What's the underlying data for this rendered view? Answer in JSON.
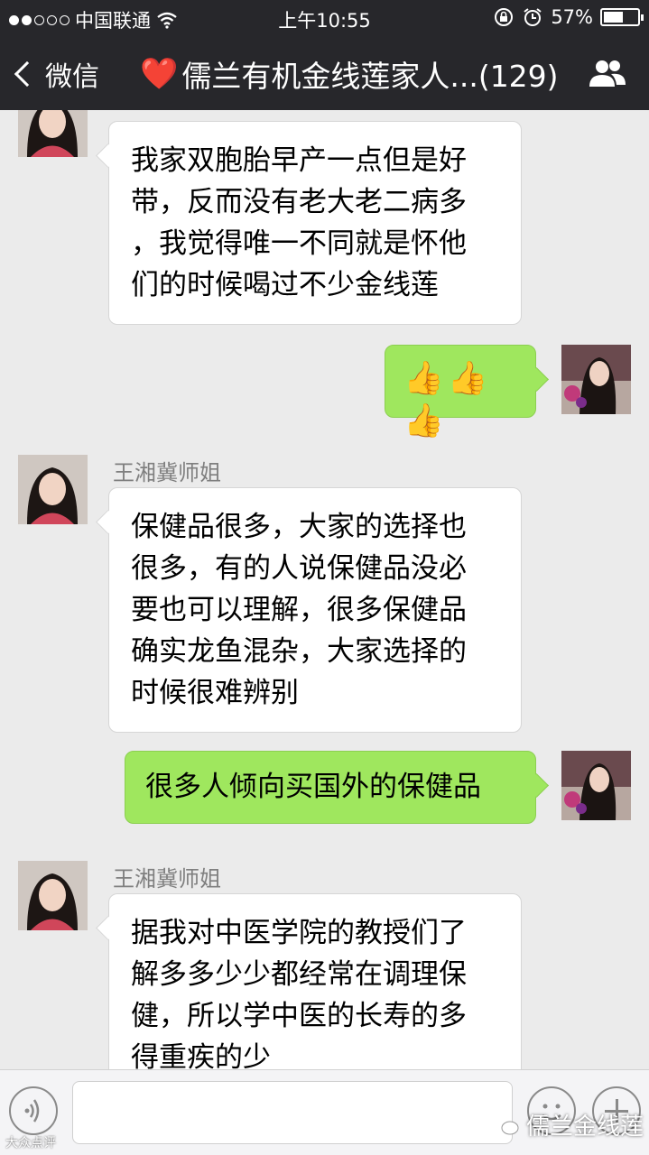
{
  "status_bar": {
    "carrier": "中国联通",
    "time": "上午10:55",
    "battery_percent": "57%",
    "battery_level": 0.57
  },
  "nav": {
    "back_label": "微信",
    "title": "儒兰有机金线莲家人...(129)",
    "heart_glyph": "❤️"
  },
  "messages": [
    {
      "side": "in",
      "sender": "",
      "lines": [
        "我家双胞胎早产一点但是好",
        "带，反而没有老大老二病多",
        "，我觉得唯一不同就是怀他",
        "们的时候喝过不少金线莲"
      ]
    },
    {
      "side": "out",
      "text": "👍👍👍"
    },
    {
      "side": "in",
      "sender": "王湘冀师姐",
      "lines": [
        "保健品很多，大家的选择也",
        "很多，有的人说保健品没必",
        "要也可以理解，很多保健品",
        "确实龙鱼混杂，大家选择的",
        "时候很难辨别"
      ]
    },
    {
      "side": "out",
      "text": "很多人倾向买国外的保健品"
    },
    {
      "side": "in",
      "sender": "王湘冀师姐",
      "lines": [
        "据我对中医学院的教授们了",
        "解多多少少都经常在调理保",
        "健，所以学中医的长寿的多",
        "得重疾的少"
      ]
    }
  ],
  "input_bar": {
    "text_value": ""
  },
  "watermarks": {
    "account": "儒兰金线莲",
    "corner": "大众点评"
  },
  "colors": {
    "nav_bg": "#27272b",
    "chat_bg": "#ebebeb",
    "out_bubble": "#9fe75e",
    "in_bubble": "#ffffff"
  }
}
